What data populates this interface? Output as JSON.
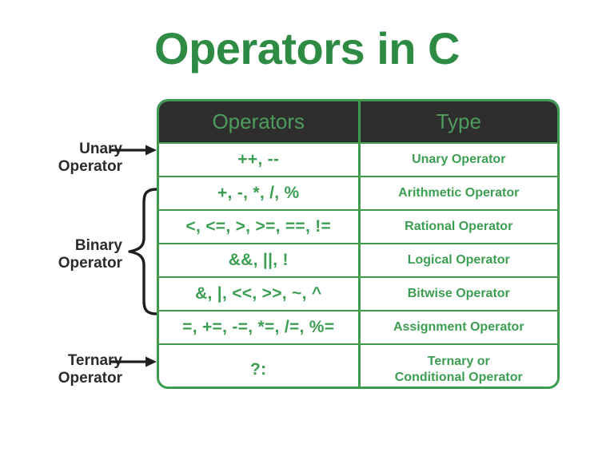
{
  "page": {
    "title": "Operators in C",
    "background_color": "#ffffff",
    "accent_green": "#2e8b43",
    "border_green": "#3f9c4f",
    "cell_text_green": "#3c9e52",
    "header_text_green": "#4e9c5c",
    "header_background": "#2e2e2e",
    "annotation_color": "#2b2b2b"
  },
  "table": {
    "columns": [
      "Operators",
      "Type"
    ],
    "rows": [
      {
        "operators": "++, --",
        "type": "Unary Operator",
        "type_line_1": "Unary Operator",
        "type_line_2": ""
      },
      {
        "operators": "+, -, *, /, %",
        "type": "Arithmetic Operator",
        "type_line_1": "Arithmetic Operator",
        "type_line_2": ""
      },
      {
        "operators": "<, <=, >, >=, ==, !=",
        "type": "Rational Operator",
        "type_line_1": "Rational Operator",
        "type_line_2": ""
      },
      {
        "operators": "&&, ||, !",
        "type": "Logical Operator",
        "type_line_1": "Logical Operator",
        "type_line_2": ""
      },
      {
        "operators": "&, |, <<, >>, ~, ^",
        "type": "Bitwise Operator",
        "type_line_1": "Bitwise Operator",
        "type_line_2": ""
      },
      {
        "operators": "=, +=, -=, *=, /=, %=",
        "type": "Assignment Operator",
        "type_line_1": "Assignment Operator",
        "type_line_2": ""
      },
      {
        "operators": "?:",
        "type": "Ternary or Conditional Operator",
        "type_line_1": "Ternary or",
        "type_line_2": "Conditional Operator"
      }
    ]
  },
  "annotations": [
    {
      "id": "unary",
      "line1": "Unary",
      "line2": "Operator",
      "marker": "arrow-right-icon",
      "targets_rows": [
        0
      ]
    },
    {
      "id": "binary",
      "line1": "Binary",
      "line2": "Operator",
      "marker": "curly-brace-icon",
      "targets_rows": [
        1,
        2,
        3,
        4,
        5
      ]
    },
    {
      "id": "ternary",
      "line1": "Ternary",
      "line2": "Operator",
      "marker": "arrow-right-icon",
      "targets_rows": [
        6
      ]
    }
  ]
}
